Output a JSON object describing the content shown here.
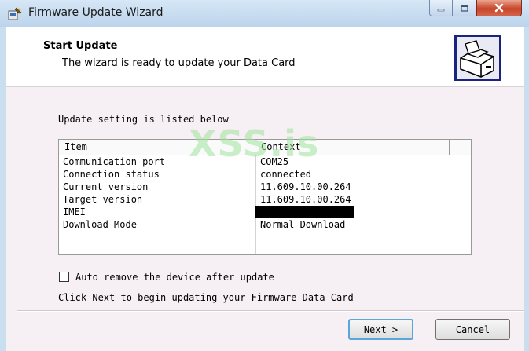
{
  "window": {
    "title": "Firmware Update Wizard",
    "accent": "#c9dff0",
    "close_color": "#c8452b"
  },
  "icons": {
    "app": "wizard-app-icon",
    "minimize": "minimize-icon",
    "maximize": "maximize-icon",
    "close": "close-icon",
    "header": "computer-install-icon"
  },
  "header": {
    "title": "Start Update",
    "subtitle": "The wizard is ready to update your Data Card"
  },
  "watermark": "XSS.is",
  "body": {
    "intro": "Update setting is listed below",
    "columns": [
      "Item",
      "Context"
    ],
    "rows": [
      {
        "item": "Communication port",
        "context": "COM25"
      },
      {
        "item": "Connection status",
        "context": "connected"
      },
      {
        "item": "Current version",
        "context": "11.609.10.00.264"
      },
      {
        "item": "Target version",
        "context": "11.609.10.00.264"
      },
      {
        "item": "IMEI",
        "context": ""
      },
      {
        "item": "Download Mode",
        "context": "Normal Download"
      }
    ],
    "checkbox_label": "Auto remove the device after update",
    "checkbox_checked": false,
    "hint": "Click Next to begin updating your Firmware Data Card"
  },
  "buttons": {
    "next": "Next >",
    "cancel": "Cancel"
  }
}
